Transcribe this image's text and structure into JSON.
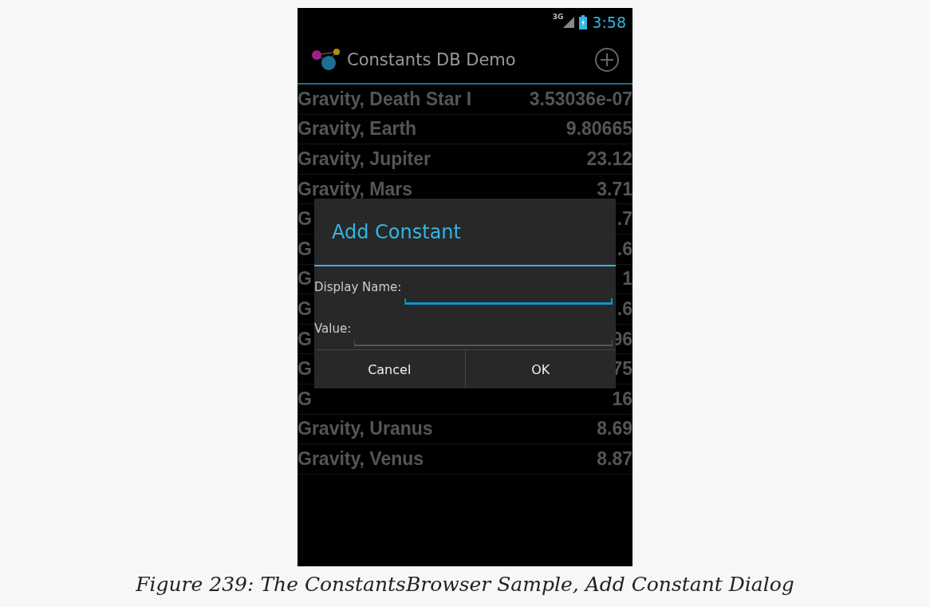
{
  "status_bar": {
    "network": "3G",
    "time": "3:58"
  },
  "action_bar": {
    "title": "Constants DB Demo"
  },
  "rows": [
    {
      "name": "Gravity, Death Star I",
      "value": "3.53036e-07"
    },
    {
      "name": "Gravity, Earth",
      "value": "9.80665"
    },
    {
      "name": "Gravity, Jupiter",
      "value": "23.12"
    },
    {
      "name": "Gravity, Mars",
      "value": "3.71"
    },
    {
      "name": "G",
      "value": ".7"
    },
    {
      "name": "G",
      "value": ".6"
    },
    {
      "name": "G",
      "value": "1"
    },
    {
      "name": "G",
      "value": ".6"
    },
    {
      "name": "G",
      "value": "96"
    },
    {
      "name": "G",
      "value": "75"
    },
    {
      "name": "G",
      "value": "16"
    },
    {
      "name": "Gravity, Uranus",
      "value": "8.69"
    },
    {
      "name": "Gravity, Venus",
      "value": "8.87"
    }
  ],
  "dialog": {
    "title": "Add Constant",
    "fields": [
      {
        "label": "Display Name:",
        "focused": true
      },
      {
        "label": "Value:",
        "focused": false
      }
    ],
    "buttons": [
      "Cancel",
      "OK"
    ]
  },
  "caption": "Figure 239: The ConstantsBrowser Sample, Add Constant Dialog"
}
